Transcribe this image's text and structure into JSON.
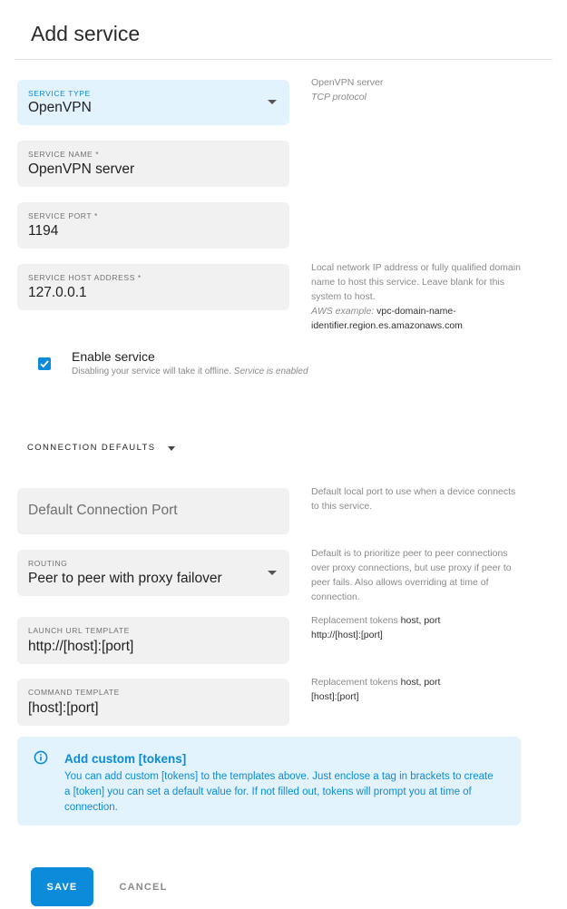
{
  "page": {
    "title": "Add service"
  },
  "service_type": {
    "label": "SERVICE TYPE",
    "value": "OpenVPN",
    "help_title": "OpenVPN server",
    "help_detail": "TCP protocol"
  },
  "service_name": {
    "label": "SERVICE NAME *",
    "value": "OpenVPN server"
  },
  "service_port": {
    "label": "SERVICE PORT *",
    "value": "1194"
  },
  "service_host": {
    "label": "SERVICE HOST ADDRESS *",
    "value": "127.0.0.1",
    "help": "Local network IP address or fully qualified domain name to host this service. Leave blank for this system to host.",
    "example_label": "AWS example:",
    "example_value": "vpc-domain-name-identifier.region.es.amazonaws.com"
  },
  "enable_service": {
    "label": "Enable service",
    "checked": true,
    "help": "Disabling your service will take it offline.",
    "status": "Service is enabled"
  },
  "connection_defaults": {
    "title": "CONNECTION DEFAULTS"
  },
  "default_port": {
    "placeholder": "Default Connection Port",
    "help": "Default local port to use when a device connects to this service."
  },
  "routing": {
    "label": "ROUTING",
    "value": "Peer to peer with proxy failover",
    "help": "Default is to prioritize peer to peer connections over proxy connections, but use proxy if peer to peer fails. Also allows overriding at time of connection."
  },
  "launch_url": {
    "label": "LAUNCH URL TEMPLATE",
    "value": "http://[host]:[port]",
    "help_prefix": "Replacement tokens",
    "help_tokens": "host, port",
    "help_example": "http://[host]:[port]"
  },
  "command_template": {
    "label": "COMMAND TEMPLATE",
    "value": "[host]:[port]",
    "help_prefix": "Replacement tokens",
    "help_tokens": "host, port",
    "help_example": "[host]:[port]"
  },
  "notice": {
    "title": "Add custom [tokens]",
    "body": "You can add custom [tokens] to the templates above. Just enclose a tag in brackets to create a [token] you can set a default value for. If not filled out, tokens will prompt you at time of connection."
  },
  "actions": {
    "save": "SAVE",
    "cancel": "CANCEL"
  },
  "colors": {
    "accent": "#0b8bd9",
    "notice_bg": "#e3f3fd",
    "field_bg": "#f1f1f1"
  }
}
